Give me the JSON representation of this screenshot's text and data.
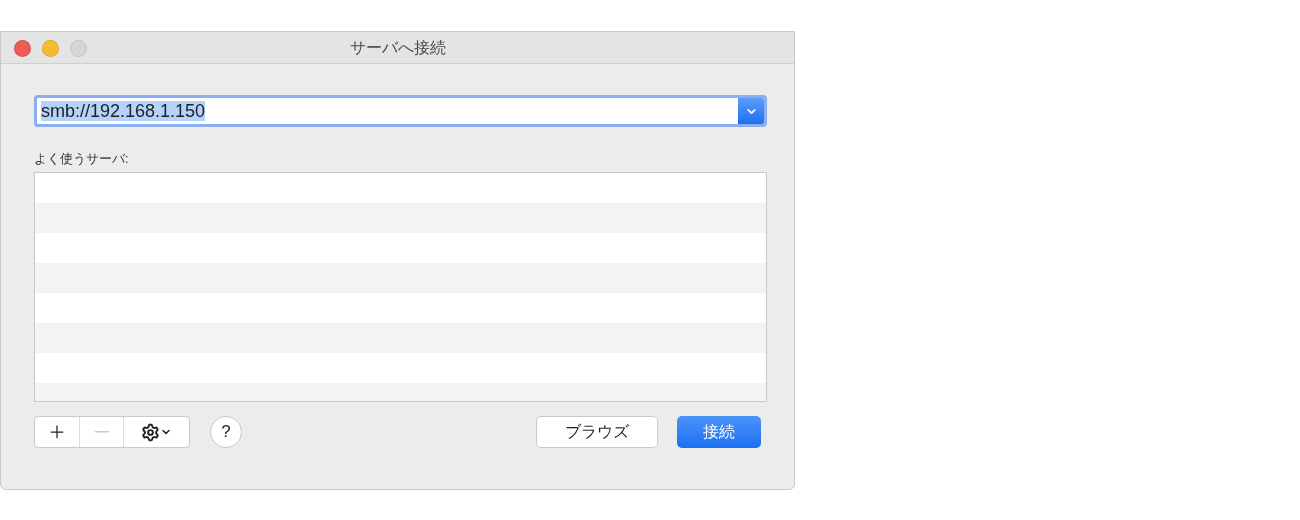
{
  "window": {
    "title": "サーバへ接続"
  },
  "traffic_lights": [
    {
      "kind": "close",
      "disabled": false
    },
    {
      "kind": "minimize",
      "disabled": false
    },
    {
      "kind": "zoom",
      "disabled": true
    }
  ],
  "address_field": {
    "value": "smb://192.168.1.150",
    "text_selected": true
  },
  "favorites_label": "よく使うサーバ:",
  "toolbar": [
    {
      "kind": "add",
      "disabled": false
    },
    {
      "kind": "remove",
      "disabled": true
    },
    {
      "kind": "actions",
      "disabled": false
    }
  ],
  "help_button": "?",
  "buttons": [
    {
      "label": "ブラウズ",
      "default": false
    },
    {
      "label": "接続",
      "default": true
    }
  ]
}
